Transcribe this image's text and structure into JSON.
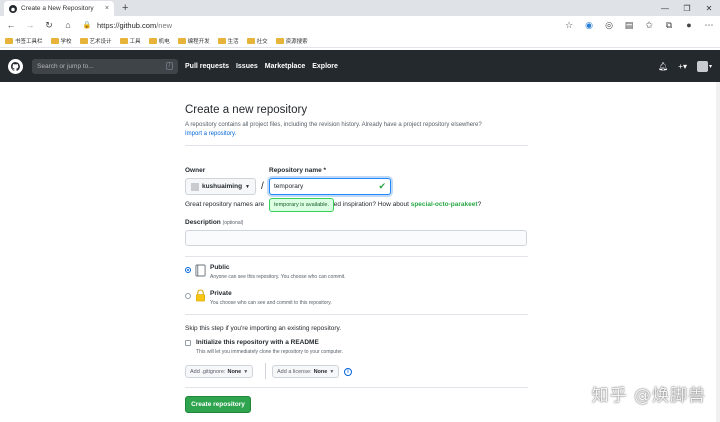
{
  "browser": {
    "tab_title": "Create a New Repository",
    "tab_close": "×",
    "new_tab": "+",
    "url_prefix": "https://",
    "url_host": "github.com",
    "url_path": "/new",
    "window_controls": [
      "—",
      "❐",
      "✕"
    ]
  },
  "bookmarks": [
    "书签工具栏",
    "学校",
    "艺术设计",
    "工具",
    "机电",
    "编程开发",
    "生活",
    "社交",
    "资源搜索"
  ],
  "header": {
    "search_placeholder": "Search or jump to...",
    "search_key": "/",
    "links": [
      "Pull requests",
      "Issues",
      "Marketplace",
      "Explore"
    ],
    "plus_label": "+▾",
    "avatar_caret": "▾"
  },
  "page": {
    "title": "Create a new repository",
    "subtitle_text": "A repository contains all project files, including the revision history. Already have a project repository elsewhere?",
    "import_link": "Import a repository.",
    "owner_label": "Owner",
    "owner_name": "kushuaiming",
    "repo_label": "Repository name *",
    "repo_value": "temporary",
    "slash": "/",
    "hint_prefix": "Great repository names are",
    "hint_middle": "eed inspiration? How about",
    "hint_suggestion": "special-octo-parakeet",
    "hint_end": "?",
    "tooltip": "temporary is available.",
    "description_label": "Description",
    "description_optional": "(optional)",
    "public_title": "Public",
    "public_note": "Anyone can see this repository. You choose who can commit.",
    "private_title": "Private",
    "private_note": "You choose who can see and commit to this repository.",
    "skip_text": "Skip this step if you're importing an existing repository.",
    "init_label": "Initialize this repository with a README",
    "init_note": "This will let you immediately clone the repository to your computer.",
    "gitignore_label": "Add .gitignore:",
    "gitignore_value": "None",
    "license_label": "Add a license:",
    "license_value": "None",
    "info": "i",
    "create_button": "Create repository"
  },
  "watermark": "知乎 @焕脚兽",
  "colors": {
    "accent": "#0366d6",
    "success": "#28a745",
    "header_bg": "#24292e",
    "button_green": "#2ea44f"
  }
}
